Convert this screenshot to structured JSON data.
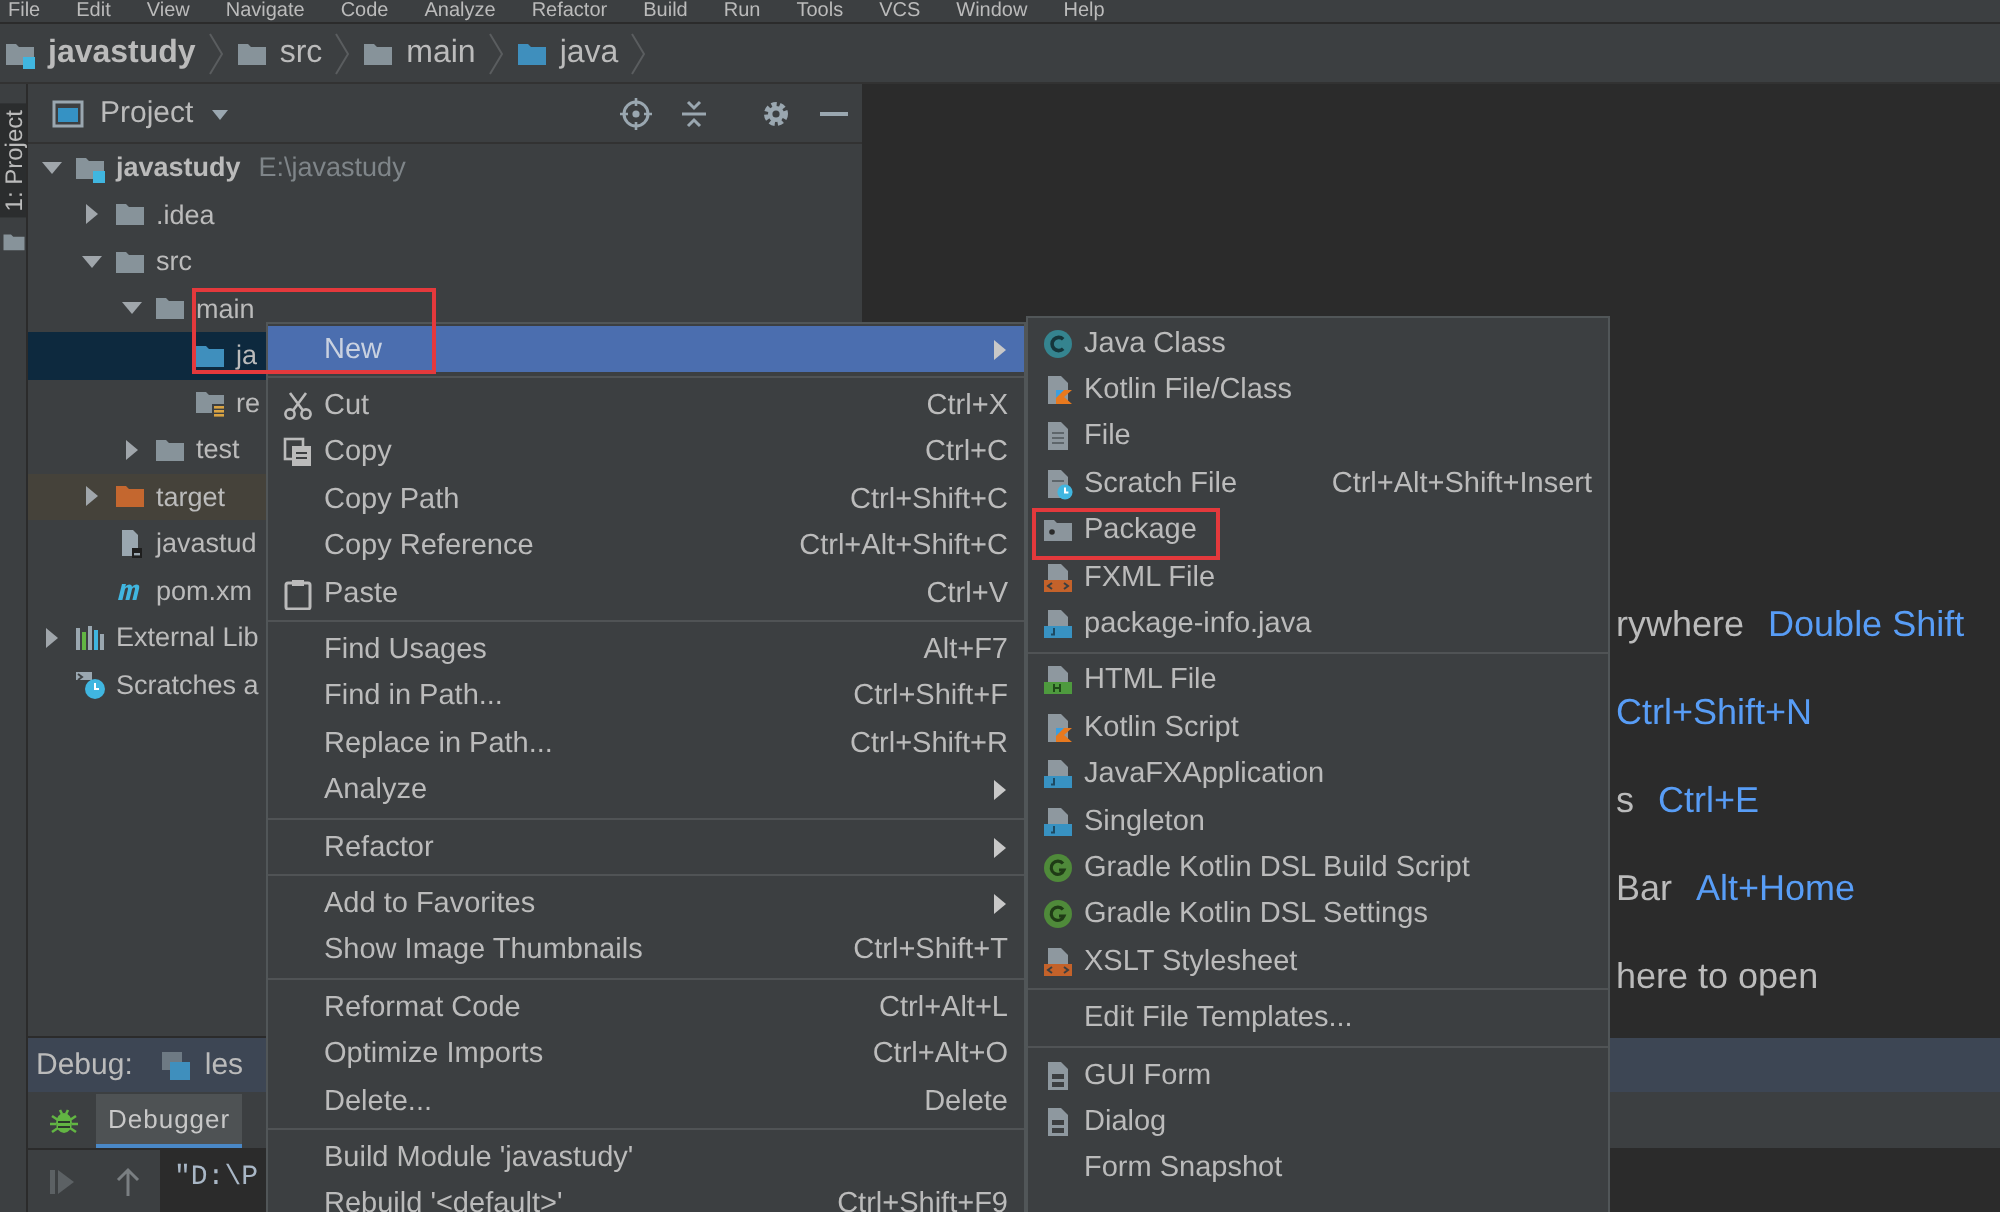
{
  "menubar": {
    "items": [
      "File",
      "Edit",
      "View",
      "Navigate",
      "Code",
      "Analyze",
      "Refactor",
      "Build",
      "Run",
      "Tools",
      "VCS",
      "Window",
      "Help"
    ]
  },
  "breadcrumbs": [
    {
      "label": "javastudy",
      "kind": "module",
      "bold": true
    },
    {
      "label": "src",
      "kind": "folder",
      "bold": false
    },
    {
      "label": "main",
      "kind": "folder",
      "bold": false
    },
    {
      "label": "java",
      "kind": "source-folder",
      "bold": false
    }
  ],
  "side_tabs": [
    {
      "label": "1: Project",
      "selected": true
    }
  ],
  "project": {
    "title": "Project",
    "tree": [
      {
        "label": "javastudy",
        "secondary": "E:\\javastudy",
        "kind": "module",
        "bold": true,
        "expanded": true,
        "selected": false,
        "children": [
          {
            "label": ".idea",
            "kind": "folder",
            "expanded": false,
            "selected": false
          },
          {
            "label": "src",
            "kind": "folder",
            "expanded": true,
            "selected": false,
            "children": [
              {
                "label": "main",
                "kind": "folder",
                "expanded": true,
                "selected": false,
                "children": [
                  {
                    "label": "ja",
                    "kind": "source-folder",
                    "selected": true
                  },
                  {
                    "label": "re",
                    "kind": "resources-folder",
                    "selected": false
                  }
                ]
              },
              {
                "label": "test",
                "kind": "folder",
                "expanded": false,
                "selected": false
              }
            ]
          },
          {
            "label": "target",
            "kind": "excluded-folder",
            "expanded": false,
            "selected": false
          },
          {
            "label": "javastud",
            "kind": "module-file",
            "selected": false
          },
          {
            "label": "pom.xm",
            "kind": "maven",
            "selected": false
          }
        ]
      },
      {
        "label": "External Lib",
        "kind": "libraries",
        "expanded": false,
        "selected": false
      },
      {
        "label": "Scratches a",
        "kind": "scratches",
        "selected": false
      }
    ]
  },
  "editor": {
    "hints": [
      [
        {
          "kind": "label",
          "text": "rywhere"
        },
        {
          "kind": "shortcut",
          "text": "Double Shift"
        }
      ],
      [
        {
          "kind": "shortcut",
          "text": "Ctrl+Shift+N"
        }
      ],
      [
        {
          "kind": "label",
          "text": "s"
        },
        {
          "kind": "shortcut",
          "text": "Ctrl+E"
        }
      ],
      [
        {
          "kind": "label",
          "text": "Bar"
        },
        {
          "kind": "shortcut",
          "text": "Alt+Home"
        }
      ],
      [
        {
          "kind": "label",
          "text": "here to open"
        }
      ]
    ]
  },
  "debug": {
    "title": "Debug:",
    "session_tab": "les",
    "tabs": [
      {
        "label": "Debugger",
        "selected": true
      }
    ],
    "console_text": "\"D:\\P"
  },
  "context_menu": {
    "groups": [
      {
        "items": [
          {
            "label": "New",
            "kind": "plain",
            "submenu": true,
            "selected": true,
            "annotated": true
          }
        ]
      },
      {
        "items": [
          {
            "label": "Cut",
            "kind": "scissors",
            "shortcut": "Ctrl+X",
            "submenu": false,
            "selected": false,
            "annotated": false
          },
          {
            "label": "Copy",
            "kind": "copy",
            "shortcut": "Ctrl+C",
            "submenu": false,
            "selected": false,
            "annotated": false
          },
          {
            "label": "Copy Path",
            "kind": "plain",
            "shortcut": "Ctrl+Shift+C",
            "submenu": false,
            "selected": false,
            "annotated": false
          },
          {
            "label": "Copy Reference",
            "kind": "plain",
            "shortcut": "Ctrl+Alt+Shift+C",
            "submenu": false,
            "selected": false,
            "annotated": false
          },
          {
            "label": "Paste",
            "kind": "paste",
            "shortcut": "Ctrl+V",
            "submenu": false,
            "selected": false,
            "annotated": false
          }
        ]
      },
      {
        "items": [
          {
            "label": "Find Usages",
            "kind": "plain",
            "shortcut": "Alt+F7",
            "submenu": false,
            "selected": false,
            "annotated": false
          },
          {
            "label": "Find in Path...",
            "kind": "plain",
            "shortcut": "Ctrl+Shift+F",
            "submenu": false,
            "selected": false,
            "annotated": false
          },
          {
            "label": "Replace in Path...",
            "kind": "plain",
            "shortcut": "Ctrl+Shift+R",
            "submenu": false,
            "selected": false,
            "annotated": false
          },
          {
            "label": "Analyze",
            "kind": "plain",
            "submenu": true,
            "selected": false,
            "annotated": false
          }
        ]
      },
      {
        "items": [
          {
            "label": "Refactor",
            "kind": "plain",
            "submenu": true,
            "selected": false,
            "annotated": false
          }
        ]
      },
      {
        "items": [
          {
            "label": "Add to Favorites",
            "kind": "plain",
            "submenu": true,
            "selected": false,
            "annotated": false
          },
          {
            "label": "Show Image Thumbnails",
            "kind": "plain",
            "shortcut": "Ctrl+Shift+T",
            "submenu": false,
            "selected": false,
            "annotated": false
          }
        ]
      },
      {
        "items": [
          {
            "label": "Reformat Code",
            "kind": "plain",
            "shortcut": "Ctrl+Alt+L",
            "submenu": false,
            "selected": false,
            "annotated": false
          },
          {
            "label": "Optimize Imports",
            "kind": "plain",
            "shortcut": "Ctrl+Alt+O",
            "submenu": false,
            "selected": false,
            "annotated": false
          },
          {
            "label": "Delete...",
            "kind": "plain",
            "shortcut": "Delete",
            "submenu": false,
            "selected": false,
            "annotated": false
          }
        ]
      },
      {
        "items": [
          {
            "label": "Build Module 'javastudy'",
            "kind": "plain",
            "submenu": false,
            "selected": false,
            "annotated": false
          },
          {
            "label": "Rebuild '<default>'",
            "kind": "plain",
            "shortcut": "Ctrl+Shift+F9",
            "submenu": false,
            "selected": false,
            "annotated": false
          }
        ]
      }
    ]
  },
  "submenu": {
    "groups": [
      {
        "items": [
          {
            "label": "Java Class",
            "kind": "class",
            "annotated": false
          },
          {
            "label": "Kotlin File/Class",
            "kind": "kotlin-file",
            "annotated": false
          },
          {
            "label": "File",
            "kind": "file",
            "annotated": false
          },
          {
            "label": "Scratch File",
            "kind": "scratch",
            "shortcut": "Ctrl+Alt+Shift+Insert",
            "annotated": false
          },
          {
            "label": "Package",
            "kind": "package",
            "annotated": true
          },
          {
            "label": "FXML File",
            "kind": "fxml",
            "annotated": false
          },
          {
            "label": "package-info.java",
            "kind": "java-file",
            "annotated": false
          }
        ]
      },
      {
        "items": [
          {
            "label": "HTML File",
            "kind": "html",
            "annotated": false
          },
          {
            "label": "Kotlin Script",
            "kind": "kotlin-file",
            "annotated": false
          },
          {
            "label": "JavaFXApplication",
            "kind": "java-file",
            "annotated": false
          },
          {
            "label": "Singleton",
            "kind": "java-file",
            "annotated": false
          },
          {
            "label": "Gradle Kotlin DSL Build Script",
            "kind": "gradle",
            "annotated": false
          },
          {
            "label": "Gradle Kotlin DSL Settings",
            "kind": "gradle",
            "annotated": false
          },
          {
            "label": "XSLT Stylesheet",
            "kind": "fxml",
            "annotated": false
          }
        ]
      },
      {
        "items": [
          {
            "label": "Edit File Templates...",
            "kind": "plain",
            "annotated": false
          }
        ]
      },
      {
        "items": [
          {
            "label": "GUI Form",
            "kind": "form",
            "annotated": false
          },
          {
            "label": "Dialog",
            "kind": "form",
            "annotated": false
          },
          {
            "label": "Form Snapshot",
            "kind": "plain",
            "annotated": false
          }
        ]
      }
    ]
  }
}
